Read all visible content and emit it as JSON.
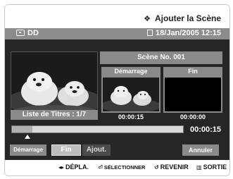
{
  "header": {
    "title": "Ajouter la Scène",
    "disc_type": "DD",
    "datetime": "18/Jan/2005 12:15"
  },
  "preview": {
    "title_list_label": "Liste de Titres : 1/7"
  },
  "scene": {
    "header": "Scène No. 001",
    "start": {
      "label": "Démarrage",
      "time": "00:00:15"
    },
    "end": {
      "label": "Fin",
      "time": "00:00:00"
    }
  },
  "timeline": {
    "current_time": "00:00:15",
    "progress_fraction": 0.12
  },
  "buttons": {
    "demarrage": "Démarrage",
    "fin": "Fin",
    "ajout": "Ajout.",
    "annuler": "Annuler"
  },
  "footer": {
    "move": "DÉPLA.",
    "select": "SÉLECTIONNER",
    "back": "REVENIR",
    "exit": "SORTIE"
  },
  "icons": {
    "title": "diamond-icon",
    "disc": "disc-icon",
    "date": "document-icon",
    "move": "left-right-arrows-icon",
    "select": "enter-icon",
    "back": "return-arrow-icon",
    "exit": "exit-icon"
  },
  "colors": {
    "body_bg": "#262626",
    "bar_grey": "#8a8a8a",
    "selected_button": "#bdbdbd"
  }
}
